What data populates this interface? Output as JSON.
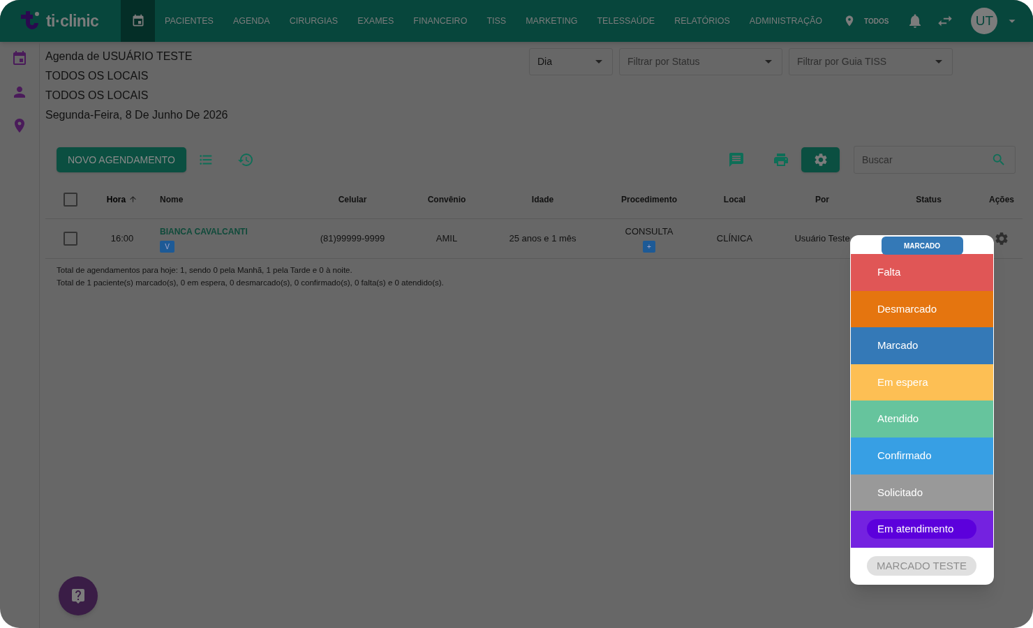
{
  "nav": {
    "brand": "ti·clinic",
    "items": [
      {
        "kind": "icon",
        "selected": true
      },
      {
        "kind": "text",
        "label": "PACIENTES",
        "selected": false
      },
      {
        "kind": "text",
        "label": "AGENDA",
        "selected": false
      },
      {
        "kind": "text",
        "label": "CIRURGIAS",
        "selected": false
      },
      {
        "kind": "text",
        "label": "EXAMES",
        "selected": false
      },
      {
        "kind": "text",
        "label": "FINANCEIRO",
        "selected": false
      },
      {
        "kind": "text",
        "label": "TISS",
        "selected": false
      },
      {
        "kind": "text",
        "label": "MARKETING",
        "selected": false
      },
      {
        "kind": "text",
        "label": "TELESSAÚDE",
        "selected": false
      },
      {
        "kind": "text",
        "label": "RELATÓRIOS",
        "selected": false
      },
      {
        "kind": "text",
        "label": "ADMINISTRAÇÃO",
        "selected": false
      }
    ],
    "location": "TODOS",
    "avatar": "UT"
  },
  "header_lines": [
    "Agenda de USUÁRIO TESTE",
    "TODOS OS LOCAIS",
    "TODOS OS LOCAIS",
    "Segunda-Feira, 8 De Junho De 2026"
  ],
  "filters": [
    {
      "value": "Dia"
    },
    {
      "placeholder": "Filtrar por Status"
    },
    {
      "placeholder": "Filtrar por Guia TISS"
    }
  ],
  "toolbar": {
    "new_button": "NOVO AGENDAMENTO",
    "search": {
      "placeholder": "Buscar"
    }
  },
  "table": {
    "select_all": {
      "checked": false
    },
    "columns": [
      {
        "label": "Hora",
        "sorted": true
      },
      {
        "label": "Nome",
        "sorted": false
      },
      {
        "label": "Celular",
        "sorted": false
      },
      {
        "label": "Convênio",
        "sorted": false
      },
      {
        "label": "Idade",
        "sorted": false
      },
      {
        "label": "Procedimento",
        "sorted": false
      },
      {
        "label": "Local",
        "sorted": false
      },
      {
        "label": "Por",
        "sorted": false
      },
      {
        "label": "Status",
        "sorted": false
      },
      {
        "label": "Ações",
        "sorted": false
      }
    ],
    "rows": [
      {
        "checked": false,
        "hora": "16:00",
        "nome": "BIANCA CAVALCANTI",
        "nome_badge": "V",
        "celular": "(81)99999-9999",
        "convenio": "AMIL",
        "idade": "25 anos e 1 mês",
        "procedimento": "CONSULTA",
        "procedimento_badge": "+",
        "local": "CLÍNICA",
        "por": "Usuário Teste"
      }
    ]
  },
  "summary": [
    "Total de agendamentos para hoje: 1, sendo 0 pela Manhã, 1 pela Tarde e 0 à noite.",
    "Total de 1 paciente(s) marcado(s), 0 em espera, 0 desmarcado(s), 0 confirmado(s), 0 falta(s) e 0 atendido(s)."
  ],
  "status_menu": {
    "current": "MARCADO",
    "options": [
      {
        "label": "Falta",
        "color": "#e05656",
        "focused": false,
        "disabled": false
      },
      {
        "label": "Desmarcado",
        "color": "#e5750f",
        "focused": false,
        "disabled": false
      },
      {
        "label": "Marcado",
        "color": "#3479b7",
        "focused": false,
        "disabled": false
      },
      {
        "label": "Em espera",
        "color": "#fdbf54",
        "focused": false,
        "disabled": false
      },
      {
        "label": "Atendido",
        "color": "#66c49d",
        "focused": false,
        "disabled": false
      },
      {
        "label": "Confirmado",
        "color": "#379fe4",
        "focused": false,
        "disabled": false
      },
      {
        "label": "Solicitado",
        "color": "#999999",
        "focused": false,
        "disabled": false
      },
      {
        "label": "Em atendimento",
        "color": "#7422e0",
        "focused": true,
        "disabled": false
      },
      {
        "label": "MARCADO TESTE",
        "color": "#ffffff",
        "focused": false,
        "disabled": true
      }
    ]
  }
}
